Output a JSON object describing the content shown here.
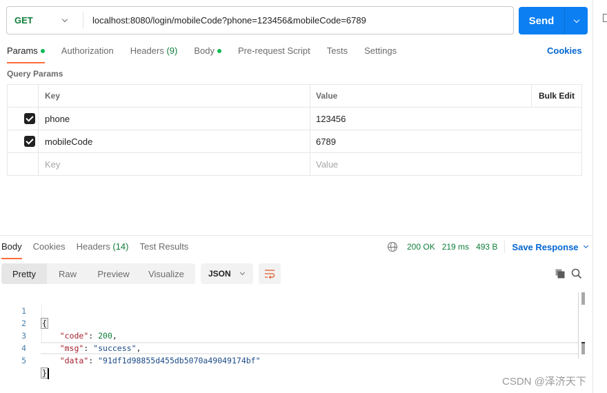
{
  "request": {
    "method": "GET",
    "url": "localhost:8080/login/mobileCode?phone=123456&mobileCode=6789",
    "send_label": "Send"
  },
  "request_tabs": [
    {
      "label": "Params",
      "dot": true,
      "active": true
    },
    {
      "label": "Authorization"
    },
    {
      "label": "Headers",
      "count": "(9)"
    },
    {
      "label": "Body",
      "dot": true
    },
    {
      "label": "Pre-request Script"
    },
    {
      "label": "Tests"
    },
    {
      "label": "Settings"
    }
  ],
  "cookies_label": "Cookies",
  "query_params": {
    "title": "Query Params",
    "headers": {
      "key": "Key",
      "value": "Value",
      "bulk_edit": "Bulk Edit"
    },
    "rows": [
      {
        "checked": true,
        "key": "phone",
        "value": "123456"
      },
      {
        "checked": true,
        "key": "mobileCode",
        "value": "6789"
      }
    ],
    "placeholder": {
      "key": "Key",
      "value": "Value"
    }
  },
  "response": {
    "tabs": [
      {
        "label": "Body",
        "active": true
      },
      {
        "label": "Cookies"
      },
      {
        "label": "Headers",
        "count": "(14)"
      },
      {
        "label": "Test Results"
      }
    ],
    "status": "200 OK",
    "time": "219 ms",
    "size": "493 B",
    "save_label": "Save Response",
    "view_tabs": [
      "Pretty",
      "Raw",
      "Preview",
      "Visualize"
    ],
    "format": "JSON",
    "body_lines": [
      {
        "n": "1"
      },
      {
        "n": "2",
        "key": "\"code\"",
        "value": "200",
        "type": "number",
        "trail": ","
      },
      {
        "n": "3",
        "key": "\"msg\"",
        "value": "\"success\"",
        "type": "string",
        "trail": ","
      },
      {
        "n": "4",
        "key": "\"data\"",
        "value": "\"91df1d98855d455db5070a49049174bf\"",
        "type": "string",
        "trail": ""
      },
      {
        "n": "5"
      }
    ],
    "open_brace": "{",
    "close_brace": "}"
  },
  "colors": {
    "accent": "#ff6c37",
    "send": "#0c7ff2",
    "success": "#0f7d3a",
    "link": "#0265d2"
  },
  "watermark": "CSDN @泽济天下"
}
